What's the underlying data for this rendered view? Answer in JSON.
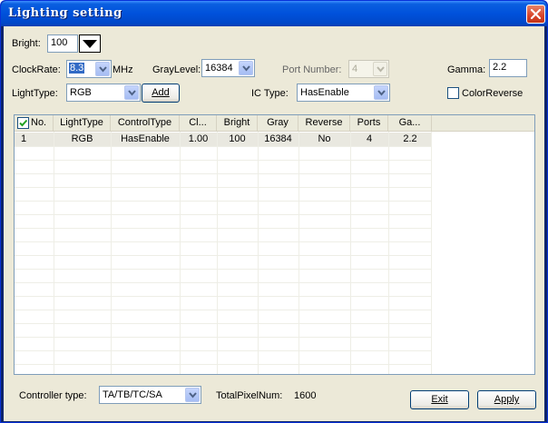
{
  "window": {
    "title": "Lighting setting"
  },
  "bright": {
    "label": "Bright:",
    "value": "100"
  },
  "clockrate": {
    "label": "ClockRate:",
    "value": "8.3",
    "unit": "MHz"
  },
  "graylevel": {
    "label": "GrayLevel:",
    "value": "16384"
  },
  "portnumber": {
    "label": "Port Number:",
    "value": "4"
  },
  "gamma": {
    "label": "Gamma:",
    "value": "2.2"
  },
  "lighttype": {
    "label": "LightType:",
    "value": "RGB",
    "add_label": "Add"
  },
  "ictype": {
    "label": "IC Type:",
    "value": "HasEnable"
  },
  "colorreverse": {
    "label": "ColorReverse",
    "checked": false
  },
  "table": {
    "columns": [
      "No.",
      "LightType",
      "ControlType",
      "Cl...",
      "Bright",
      "Gray",
      "Reverse",
      "Ports",
      "Ga..."
    ],
    "rows": [
      [
        "1",
        "RGB",
        "HasEnable",
        "1.00",
        "100",
        "16384",
        "No",
        "4",
        "2.2"
      ]
    ]
  },
  "footer": {
    "controller_label": "Controller type:",
    "controller_value": "TA/TB/TC/SA",
    "total_label": "TotalPixelNum:",
    "total_value": "1600",
    "exit_label": "Exit",
    "apply_label": "Apply"
  }
}
